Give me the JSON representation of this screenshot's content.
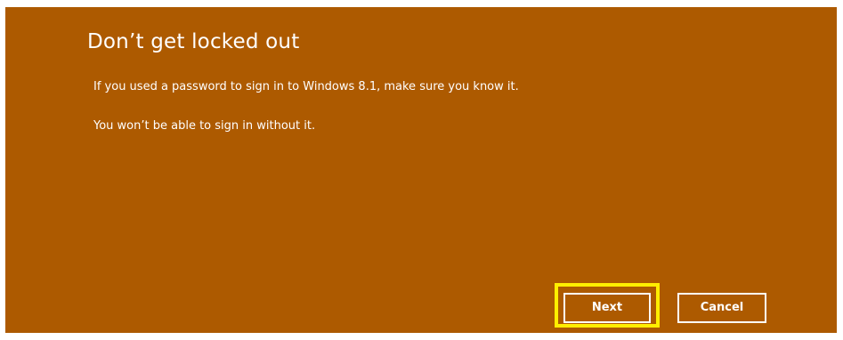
{
  "dialog": {
    "title": "Don’t get locked out",
    "line1": "If you used a password to sign in to Windows 8.1, make sure you know it.",
    "line2": "You won’t be able to sign in without it."
  },
  "buttons": {
    "next_label": "Next",
    "cancel_label": "Cancel"
  },
  "colors": {
    "background": "#ad5a00",
    "text": "#ffffff",
    "focus_highlight": "#ffee00"
  }
}
